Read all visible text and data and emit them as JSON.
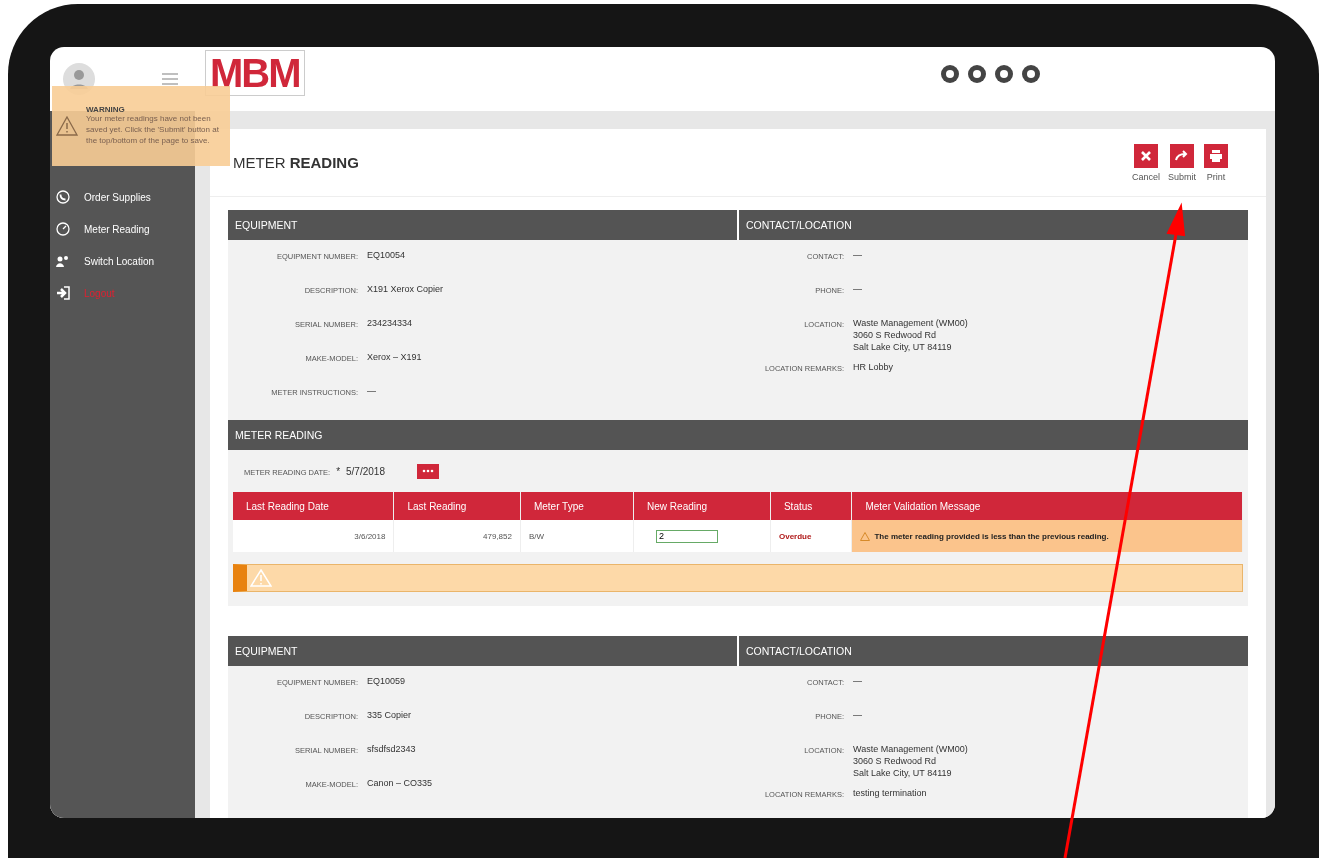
{
  "header": {
    "logo": "MBM"
  },
  "sidebar": {
    "items": [
      {
        "kind": "supplies",
        "label": "Order Supplies"
      },
      {
        "kind": "meter",
        "label": "Meter Reading"
      },
      {
        "kind": "location",
        "label": "Switch Location"
      },
      {
        "kind": "logout",
        "label": "Logout"
      }
    ]
  },
  "warning": {
    "title": "WARNING",
    "message": "Your meter readings have not been saved yet. Click the 'Submit' button at the top/bottom of the page to save."
  },
  "page_title": "METER **READING**",
  "actions": [
    {
      "kind": "cancel",
      "label": "Cancel"
    },
    {
      "kind": "submit",
      "label": "Submit"
    },
    {
      "kind": "print",
      "label": "Print"
    }
  ],
  "equipment_blocks": [
    {
      "equipment_heading": "EQUIPMENT",
      "contact_heading": "CONTACT/LOCATION",
      "equipment_fields": [
        {
          "label": "EQUIPMENT NUMBER:",
          "value": "EQ10054"
        },
        {
          "label": "DESCRIPTION:",
          "value": "X191 Xerox Copier"
        },
        {
          "label": "SERIAL NUMBER:",
          "value": "234234334"
        },
        {
          "label": "MAKE-MODEL:",
          "value": "Xerox – X191"
        },
        {
          "label": "METER INSTRUCTIONS:",
          "value": "—"
        }
      ],
      "contact_fields": [
        {
          "label": "CONTACT:",
          "lines": [
            "—"
          ]
        },
        {
          "label": "PHONE:",
          "lines": [
            "—"
          ]
        },
        {
          "label": "LOCATION:",
          "lines": [
            "Waste Management (WM00)",
            "3060 S Redwood Rd",
            "Salt Lake City, UT 84119"
          ]
        },
        {
          "label": "LOCATION REMARKS:",
          "lines": [
            "HR Lobby"
          ]
        }
      ],
      "meter": {
        "heading": "METER READING",
        "date_label": "METER READING DATE:",
        "required": "*",
        "date": "5/7/2018",
        "columns": [
          "Last Reading Date",
          "Last Reading",
          "Meter Type",
          "New Reading",
          "Status",
          "Meter Validation Message"
        ],
        "rows": [
          {
            "last_date": "3/6/2018",
            "last_reading": "479,852",
            "meter_type": "B/W",
            "new_reading": "2",
            "status": "Overdue",
            "message": "The meter reading provided is less than the previous reading."
          }
        ]
      }
    },
    {
      "equipment_heading": "EQUIPMENT",
      "contact_heading": "CONTACT/LOCATION",
      "equipment_fields": [
        {
          "label": "EQUIPMENT NUMBER:",
          "value": "EQ10059"
        },
        {
          "label": "DESCRIPTION:",
          "value": "335 Copier"
        },
        {
          "label": "SERIAL NUMBER:",
          "value": "sfsdfsd2343"
        },
        {
          "label": "MAKE-MODEL:",
          "value": "Canon – CO335"
        }
      ],
      "contact_fields": [
        {
          "label": "CONTACT:",
          "lines": [
            "—"
          ]
        },
        {
          "label": "PHONE:",
          "lines": [
            "—"
          ]
        },
        {
          "label": "LOCATION:",
          "lines": [
            "Waste Management (WM00)",
            "3060 S Redwood Rd",
            "Salt Lake City, UT 84119"
          ]
        },
        {
          "label": "LOCATION REMARKS:",
          "lines": [
            "testing termination"
          ]
        }
      ]
    }
  ]
}
